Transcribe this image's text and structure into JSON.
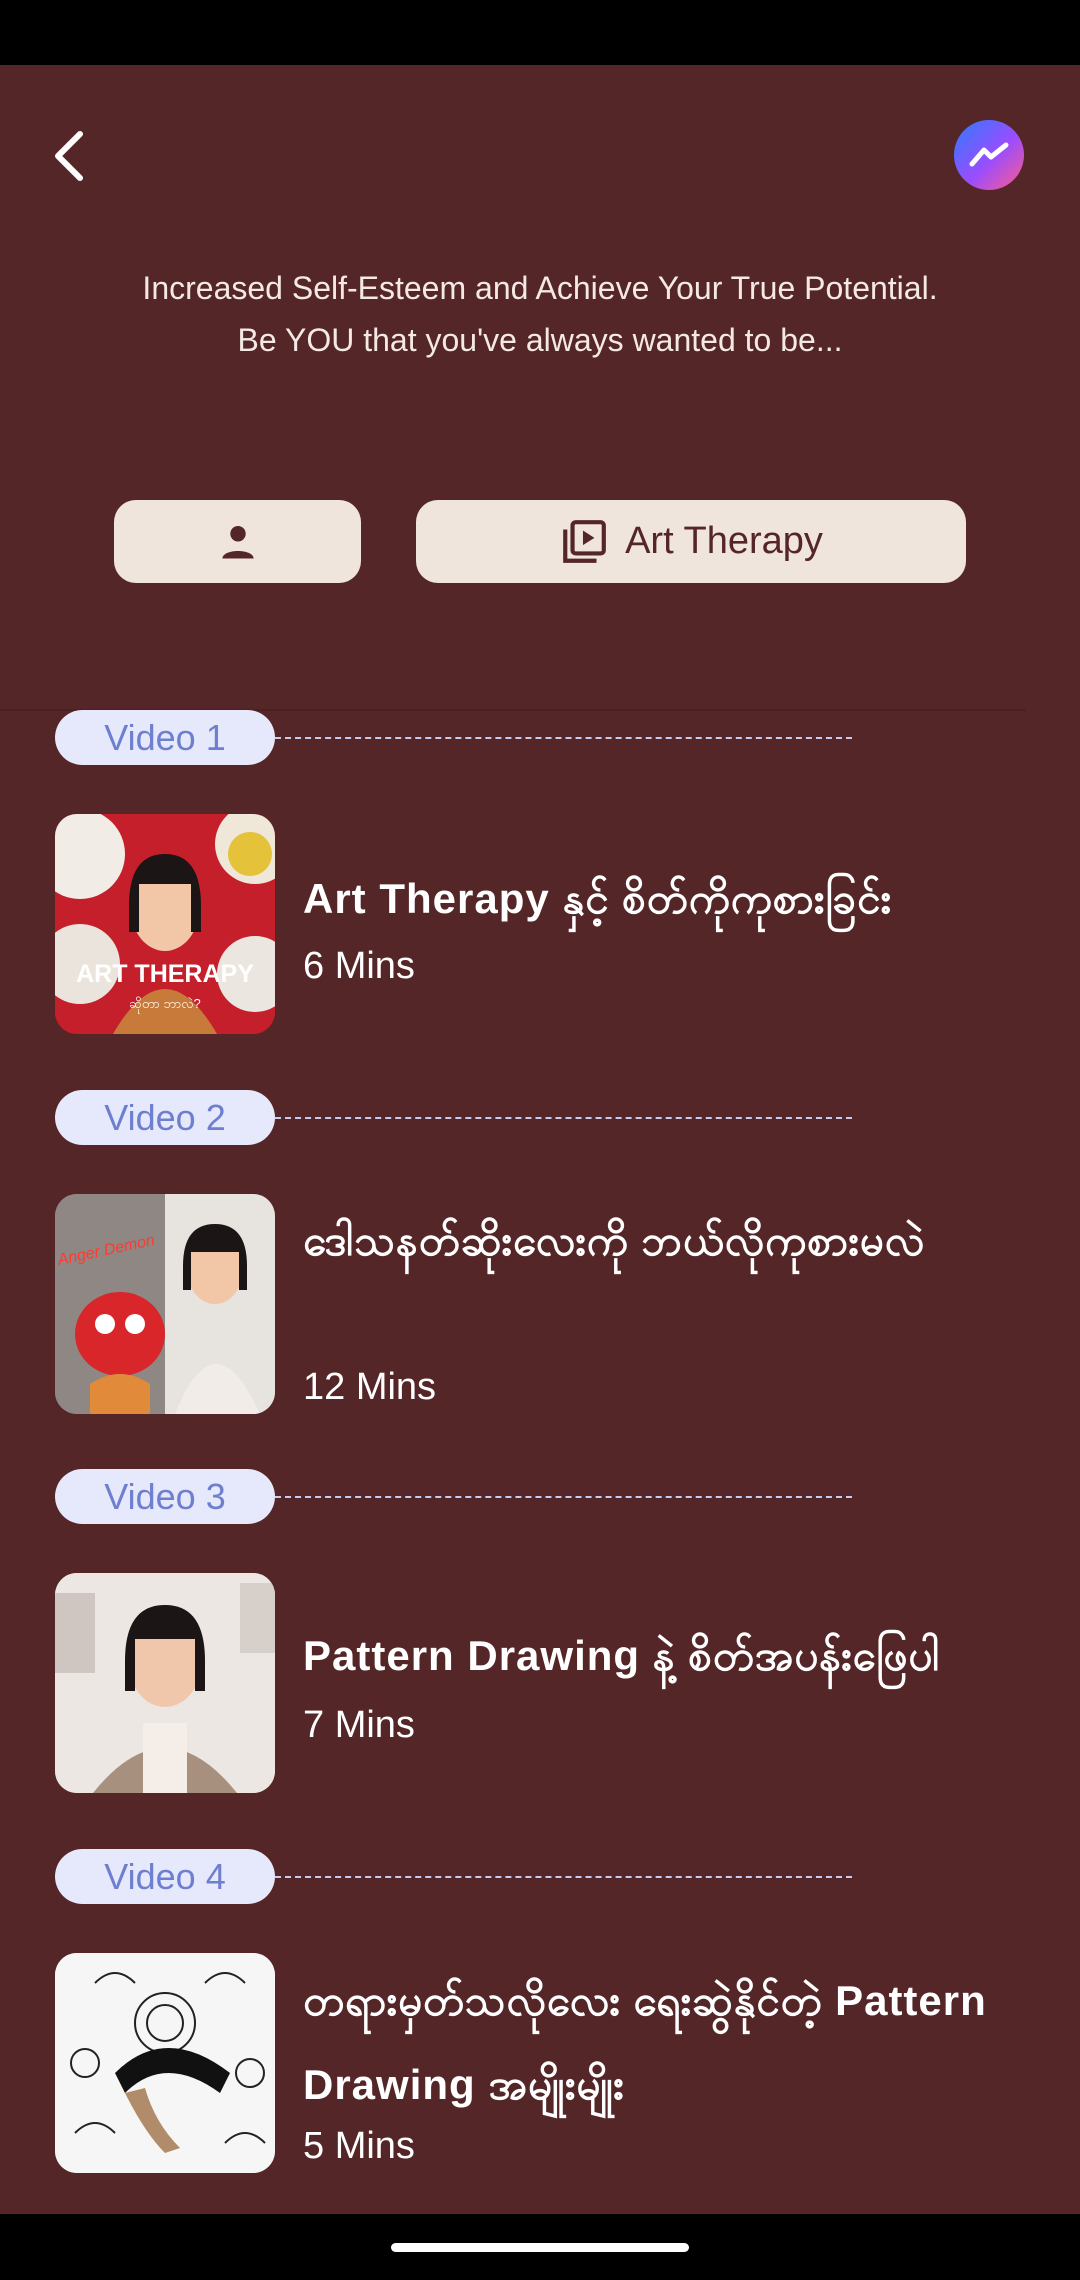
{
  "header": {
    "back_icon": "chevron-left-icon",
    "messenger_icon": "messenger-icon",
    "tagline_line1": "Increased Self-Esteem and Achieve Your True Potential.",
    "tagline_line2": "Be YOU that you've always wanted to be..."
  },
  "tabs": {
    "profile_icon": "person-icon",
    "art_icon": "video-library-icon",
    "art_label": "Art Therapy"
  },
  "videos": [
    {
      "badge": "Video 1",
      "title": "Art Therapy နှင့် စိတ်ကိုကုစားခြင်း",
      "duration": "6 Mins",
      "thumb_caption": "ART THERAPY",
      "thumb_sub": "ဆိုတာ ဘာလဲ?"
    },
    {
      "badge": "Video 2",
      "title": "ဒေါသနတ်ဆိုးလေးကို ဘယ်လိုကုစားမလဲ",
      "duration": "12 Mins",
      "thumb_caption": "Anger Demon"
    },
    {
      "badge": "Video 3",
      "title": "Pattern Drawing နဲ့ စိတ်အပန်းဖြေပါ",
      "duration": "7 Mins"
    },
    {
      "badge": "Video 4",
      "title": "တရားမှတ်သလိုလေး ရေးဆွဲနိုင်တဲ့ Pattern Drawing အမျိုးမျိုး",
      "duration": "5 Mins"
    }
  ],
  "colors": {
    "background": "#552628",
    "badge_bg": "#e6e8fb",
    "badge_text": "#6f7fd0",
    "button_bg": "#efe5dd"
  }
}
